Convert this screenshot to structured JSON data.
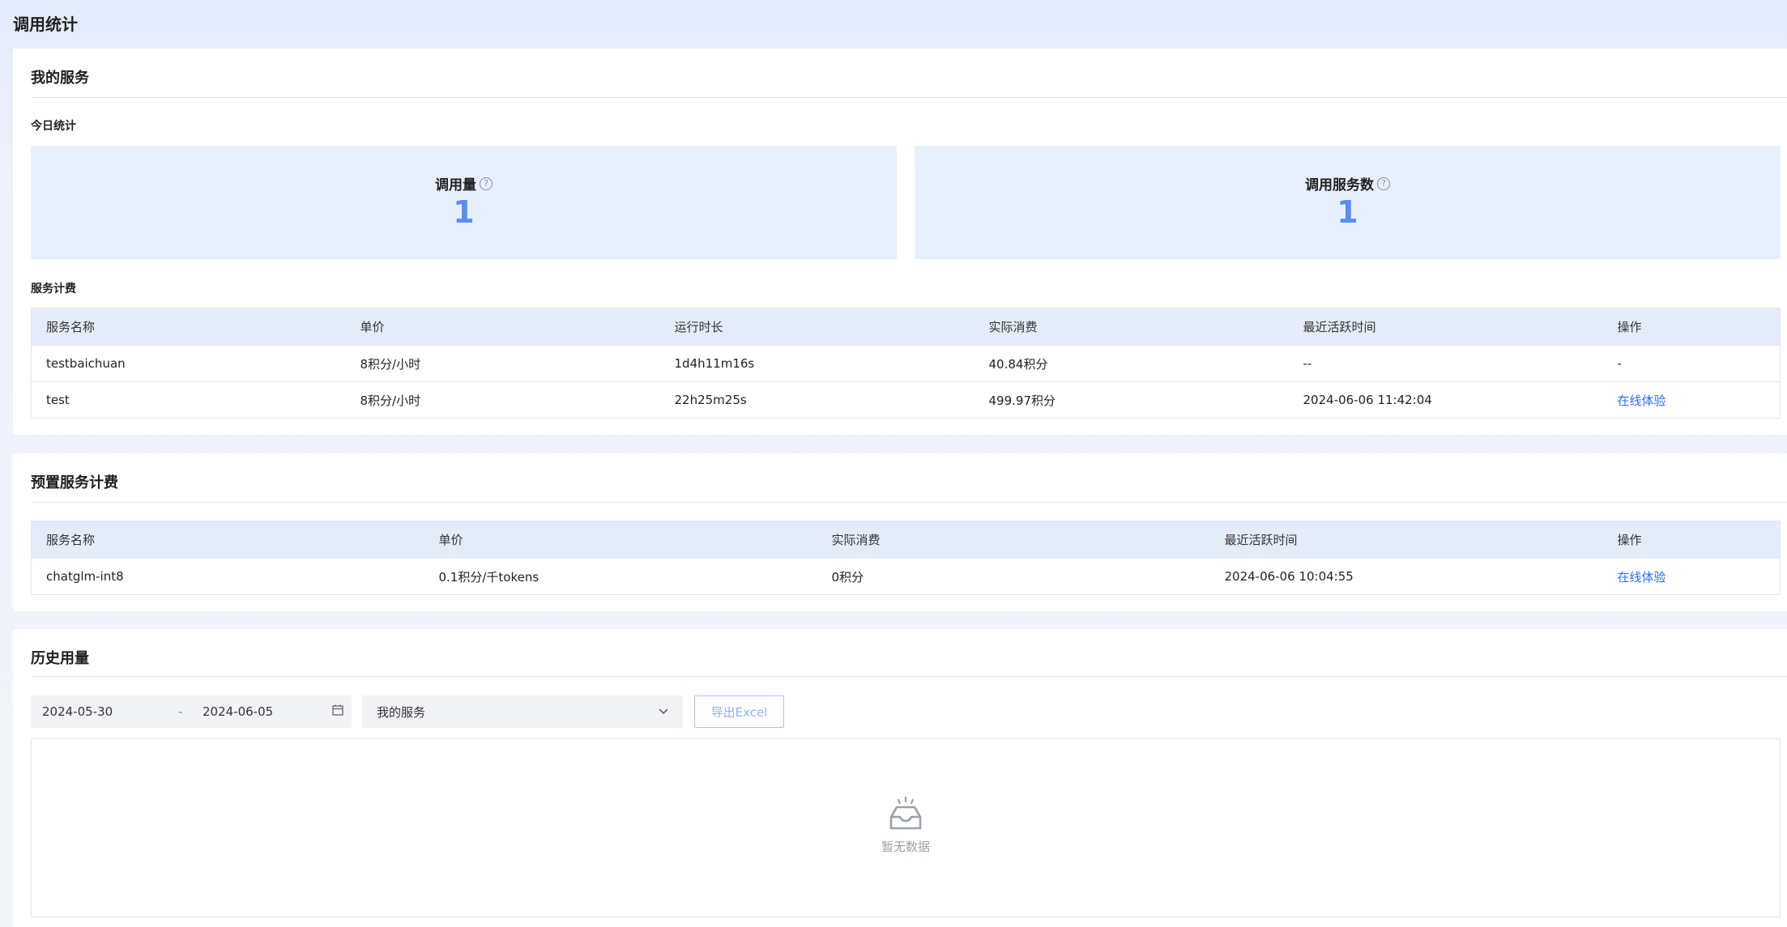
{
  "page": {
    "title": "调用统计"
  },
  "my_services": {
    "title": "我的服务",
    "today": {
      "title": "今日统计",
      "calls_label": "调用量",
      "calls_value": "1",
      "services_label": "调用服务数",
      "services_value": "1",
      "help_glyph": "?"
    },
    "billing": {
      "title": "服务计费",
      "headers": [
        "服务名称",
        "单价",
        "运行时长",
        "实际消费",
        "最近活跃时间",
        "操作"
      ],
      "rows": [
        [
          "testbaichuan",
          "8积分/小时",
          "1d4h11m16s",
          "40.84积分",
          "--",
          "-"
        ],
        [
          "test",
          "8积分/小时",
          "22h25m25s",
          "499.97积分",
          "2024-06-06 11:42:04",
          "在线体验"
        ]
      ]
    }
  },
  "preset_billing": {
    "title": "预置服务计费",
    "headers": [
      "服务名称",
      "单价",
      "实际消费",
      "最近活跃时间",
      "操作"
    ],
    "rows": [
      [
        "chatglm-int8",
        "0.1积分/千tokens",
        "0积分",
        "2024-06-06 10:04:55",
        "在线体验"
      ]
    ]
  },
  "history": {
    "title": "历史用量",
    "date_start": "2024-05-30",
    "date_sep": "-",
    "date_end": "2024-06-05",
    "calendar_icon": "calendar-icon",
    "select_value": "我的服务",
    "export_label": "导出Excel",
    "empty_text": "暂无数据",
    "empty_icon": "empty-inbox-icon"
  },
  "colors": {
    "accent": "#2c6cf0",
    "stat_value": "#5b8ef0",
    "stat_bg": "#e8effc",
    "table_header_bg": "#e4ebf9"
  }
}
